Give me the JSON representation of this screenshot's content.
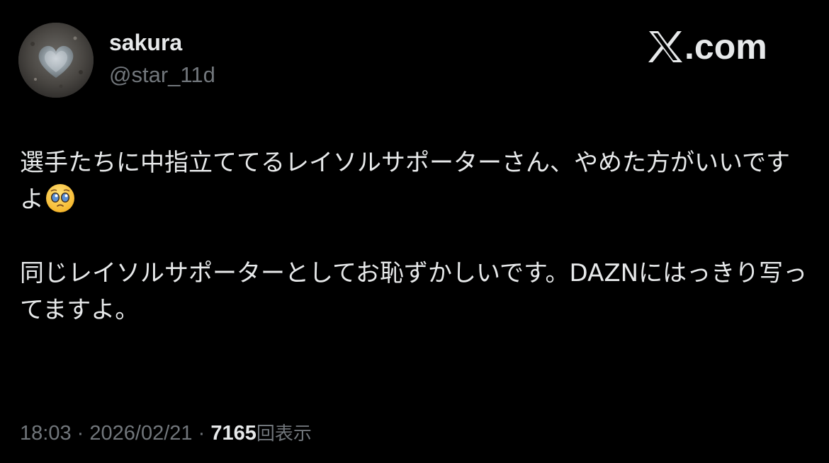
{
  "author": {
    "display_name": "sakura",
    "handle": "@star_11d",
    "avatar_icon": "heart-stone-avatar"
  },
  "brand": {
    "label": ".com",
    "icon": "x-logo-icon"
  },
  "tweet": {
    "paragraph_1": "選手たちに中指立ててるレイソルサポーターさん、やめた方がいいですよ",
    "paragraph_1_emoji": "pleading-face-emoji",
    "paragraph_2": "同じレイソルサポーターとしてお恥ずかしいです。DAZNにはっきり写ってますよ。"
  },
  "meta": {
    "time": "18:03",
    "separator": "·",
    "date": "2026/02/21",
    "views_count": "7165",
    "views_label": "回表示"
  },
  "colors": {
    "background": "#000000",
    "primary_text": "#e7e9ea",
    "secondary_text": "#71767b"
  }
}
